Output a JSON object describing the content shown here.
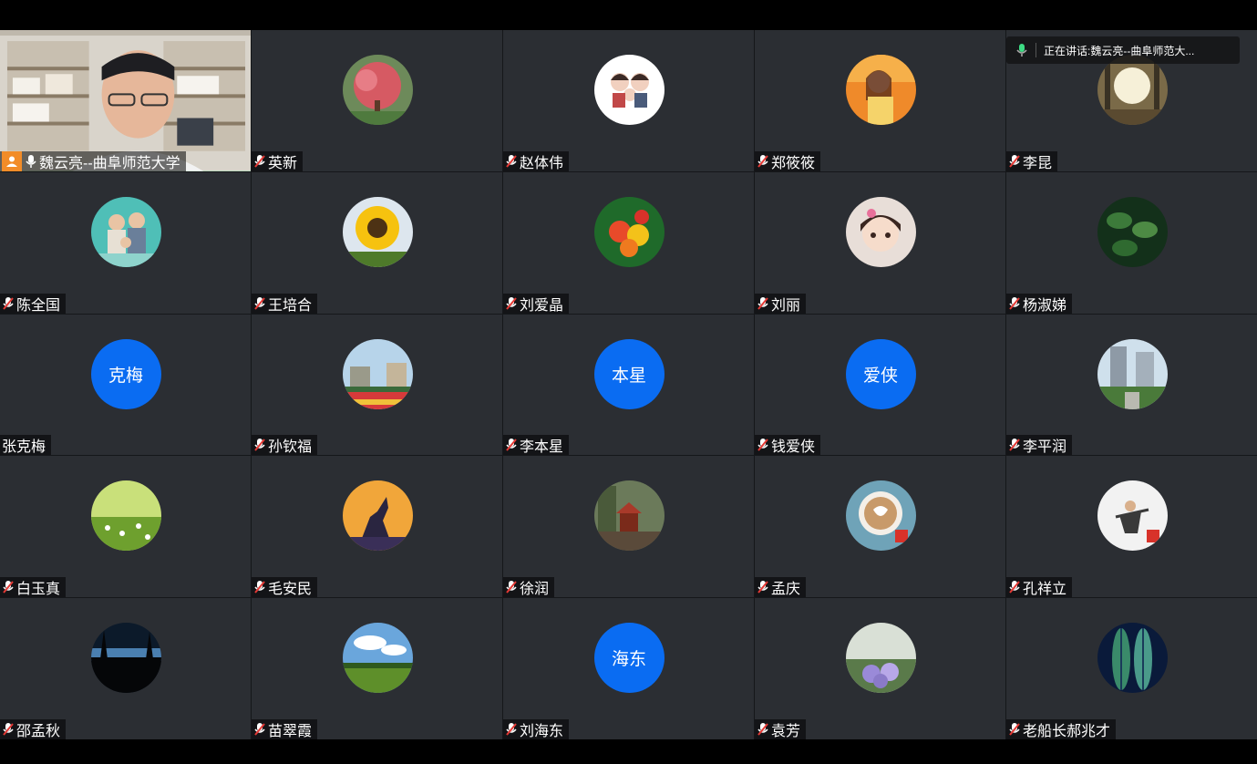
{
  "speaking": {
    "prefix": "正在讲话: ",
    "name": "魏云亮--曲阜师范大..."
  },
  "participants": [
    {
      "name": "魏云亮--曲阜师范大学",
      "host": true,
      "mic": "on"
    },
    {
      "name": "英新",
      "mic": "muted",
      "avatar_icon": "red-tree-photo"
    },
    {
      "name": "赵体伟",
      "mic": "muted",
      "avatar_icon": "cartoon-family-photo"
    },
    {
      "name": "郑筱筱",
      "mic": "muted",
      "avatar_icon": "woman-portrait-photo"
    },
    {
      "name": "李昆",
      "mic": "muted",
      "avatar_icon": "sunlit-park-photo"
    },
    {
      "name": "陈全国",
      "mic": "muted",
      "avatar_icon": "family-photo"
    },
    {
      "name": "王培合",
      "mic": "muted",
      "avatar_icon": "sunflower-photo"
    },
    {
      "name": "刘爱晶",
      "mic": "muted",
      "avatar_icon": "lantana-flowers-photo"
    },
    {
      "name": "刘丽",
      "mic": "muted",
      "avatar_icon": "cartoon-girl-photo"
    },
    {
      "name": "杨淑娣",
      "mic": "muted",
      "avatar_icon": "green-leaves-photo"
    },
    {
      "name": "张克梅",
      "mic": "none",
      "avatar_text": "克梅"
    },
    {
      "name": "孙钦福",
      "mic": "muted",
      "avatar_icon": "campus-flowers-photo"
    },
    {
      "name": "李本星",
      "mic": "muted",
      "avatar_text": "本星"
    },
    {
      "name": "钱爱侠",
      "mic": "muted",
      "avatar_text": "爱侠"
    },
    {
      "name": "李平润",
      "mic": "muted",
      "avatar_icon": "apartment-buildings-photo"
    },
    {
      "name": "白玉真",
      "mic": "muted",
      "avatar_icon": "meadow-flowers-photo"
    },
    {
      "name": "毛安民",
      "mic": "muted",
      "avatar_icon": "howling-wolf-photo"
    },
    {
      "name": "徐润",
      "mic": "muted",
      "avatar_icon": "pavilion-photo"
    },
    {
      "name": "孟庆",
      "mic": "muted",
      "avatar_icon": "latte-art-photo"
    },
    {
      "name": "孔祥立",
      "mic": "muted",
      "avatar_icon": "martial-arts-photo"
    },
    {
      "name": "邵孟秋",
      "mic": "muted",
      "avatar_icon": "dusk-trees-photo"
    },
    {
      "name": "苗翠霞",
      "mic": "muted",
      "avatar_icon": "green-field-photo"
    },
    {
      "name": "刘海东",
      "mic": "muted",
      "avatar_text": "海东"
    },
    {
      "name": "袁芳",
      "mic": "muted",
      "avatar_icon": "hydrangea-photo"
    },
    {
      "name": "老船长郝兆才",
      "mic": "muted",
      "avatar_icon": "green-feather-photo"
    }
  ],
  "colors": {
    "tile_bg": "#2b2e33",
    "text_avatar_bg": "#0a6cf2",
    "host_badge": "#f28c28",
    "active_border": "#3ddc84"
  }
}
